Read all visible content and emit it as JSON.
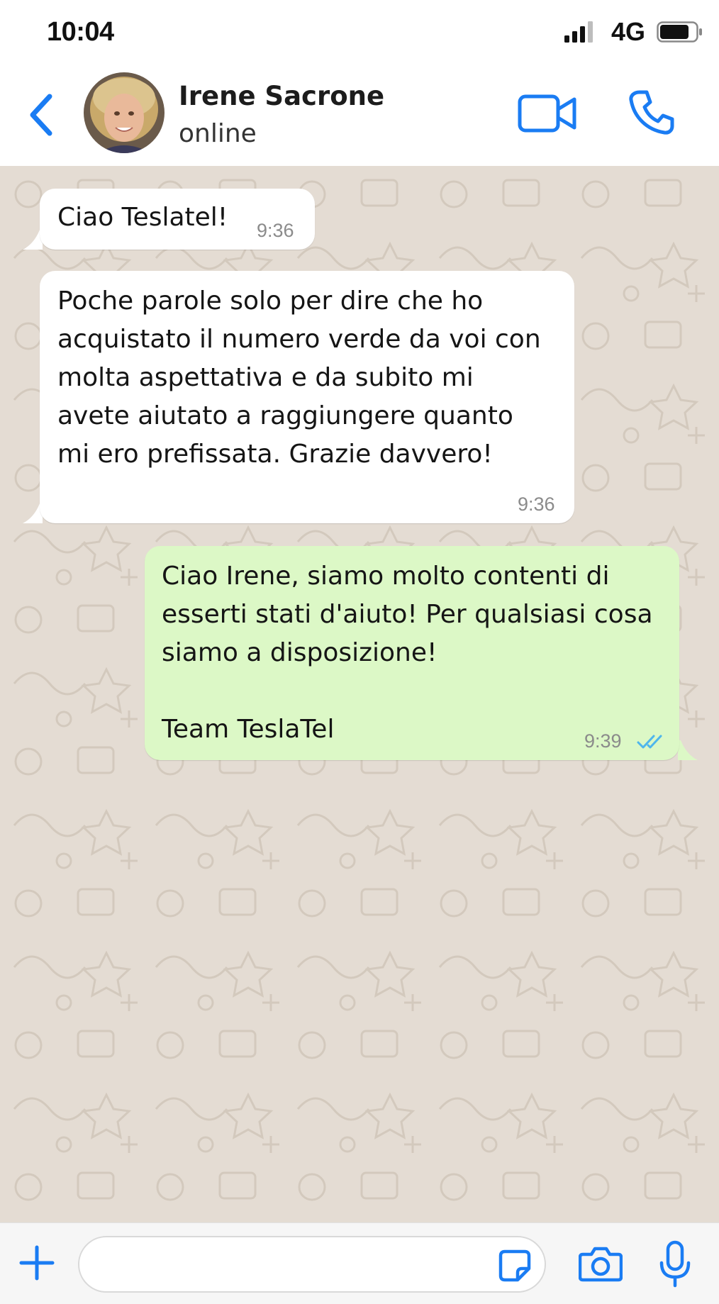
{
  "status_bar": {
    "time": "10:04",
    "network": "4G",
    "icons": [
      "signal-bars-icon",
      "battery-icon"
    ]
  },
  "header": {
    "contact_name": "Irene Sacrone",
    "contact_status": "online",
    "icons": [
      "back-chevron-icon",
      "video-call-icon",
      "voice-call-icon"
    ],
    "accent_color": "#1a7cf3"
  },
  "messages": [
    {
      "direction": "incoming",
      "text": "Ciao Teslatel!",
      "time": "9:36"
    },
    {
      "direction": "incoming",
      "text": "Poche parole solo per dire che ho\nacquistato il numero verde da voi con\nmolta aspettativa e da subito mi\navete aiutato a raggiungere quanto\nmi ero prefissata. Grazie davvero!",
      "time": "9:36"
    },
    {
      "direction": "outgoing",
      "text": "Ciao Irene, siamo molto contenti di\nesserti stati d'aiuto! Per qualsiasi cosa\nsiamo a disposizione!\n\nTeam TeslaTel",
      "time": "9:39",
      "status": "read"
    }
  ],
  "colors": {
    "chat_background": "#e4dcd3",
    "incoming_bubble": "#ffffff",
    "outgoing_bubble": "#dcf8c6",
    "read_ticks": "#4fb6ec"
  },
  "input_bar": {
    "value": "",
    "placeholder": "",
    "icons": [
      "plus-icon",
      "sticker-icon",
      "camera-icon",
      "microphone-icon"
    ]
  }
}
